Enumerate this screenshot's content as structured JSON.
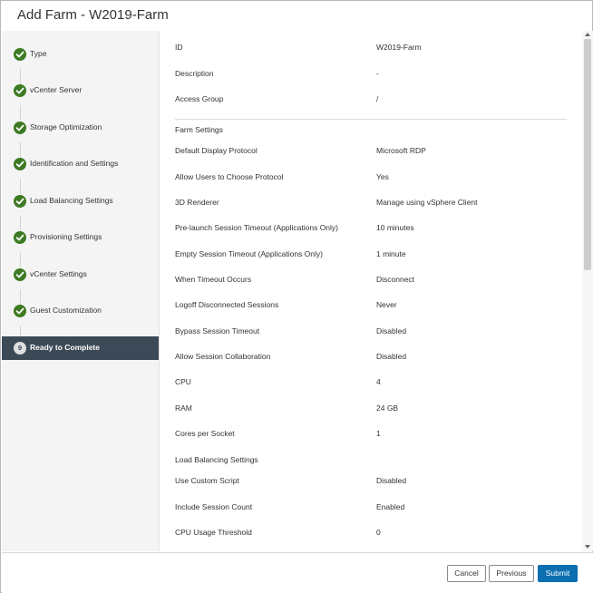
{
  "dialog": {
    "title": "Add Farm - W2019-Farm"
  },
  "colors": {
    "accent": "#0b6fb0",
    "step_complete": "#3d7a23",
    "sidebar_active": "#3c4a57"
  },
  "steps": [
    {
      "label": "Type",
      "state": "complete",
      "icon": "check-icon"
    },
    {
      "label": "vCenter Server",
      "state": "complete",
      "icon": "check-icon"
    },
    {
      "label": "Storage Optimization",
      "state": "complete",
      "icon": "check-icon"
    },
    {
      "label": "Identification and Settings",
      "state": "complete",
      "icon": "check-icon"
    },
    {
      "label": "Load Balancing Settings",
      "state": "complete",
      "icon": "check-icon"
    },
    {
      "label": "Provisioning Settings",
      "state": "complete",
      "icon": "check-icon"
    },
    {
      "label": "vCenter Settings",
      "state": "complete",
      "icon": "check-icon"
    },
    {
      "label": "Guest Customization",
      "state": "complete",
      "icon": "check-icon"
    },
    {
      "number": "9",
      "label": "Ready to Complete",
      "state": "active"
    }
  ],
  "summary": {
    "general": [
      {
        "key": "ID",
        "value": "W2019-Farm"
      },
      {
        "key": "Description",
        "value": "-"
      },
      {
        "key": "Access Group",
        "value": "/"
      }
    ],
    "farm_settings_title": "Farm Settings",
    "farm_settings": [
      {
        "key": "Default Display Protocol",
        "value": "Microsoft RDP"
      },
      {
        "key": "Allow Users to Choose Protocol",
        "value": "Yes"
      },
      {
        "key": "3D Renderer",
        "value": "Manage using vSphere Client"
      },
      {
        "key": "Pre-launch Session Timeout (Applications Only)",
        "value": "10 minutes"
      },
      {
        "key": "Empty Session Timeout (Applications Only)",
        "value": "1 minute"
      },
      {
        "key": "When Timeout Occurs",
        "value": "Disconnect"
      },
      {
        "key": "Logoff Disconnected Sessions",
        "value": "Never"
      },
      {
        "key": "Bypass Session Timeout",
        "value": "Disabled"
      },
      {
        "key": "Allow Session Collaboration",
        "value": "Disabled"
      },
      {
        "key": "CPU",
        "value": "4"
      },
      {
        "key": "RAM",
        "value": "24 GB"
      },
      {
        "key": "Cores per Socket",
        "value": "1"
      }
    ],
    "load_balancing_title": "Load Balancing Settings",
    "load_balancing": [
      {
        "key": "Use Custom Script",
        "value": "Disabled"
      },
      {
        "key": "Include Session Count",
        "value": "Enabled"
      },
      {
        "key": "CPU Usage Threshold",
        "value": "0"
      }
    ]
  },
  "footer": {
    "cancel_label": "Cancel",
    "previous_label": "Previous",
    "submit_label": "Submit"
  }
}
